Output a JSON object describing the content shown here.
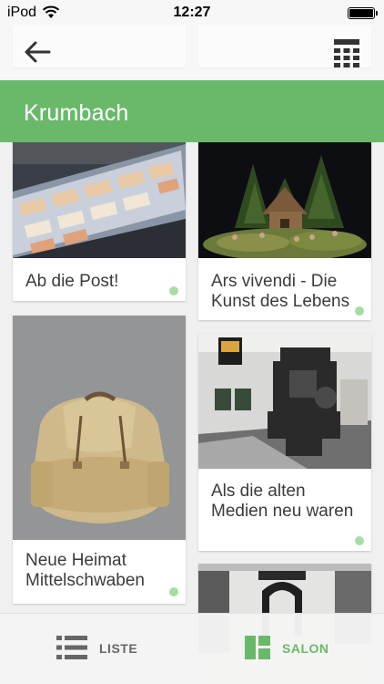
{
  "status": {
    "carrier": "iPod",
    "time": "12:27"
  },
  "nav": {
    "back_icon": "back-arrow-icon",
    "view_icon": "grid-view-icon"
  },
  "header": {
    "title": "Krumbach"
  },
  "cards": [
    {
      "label": "Ab die Post!",
      "image": "display case with postage documents"
    },
    {
      "label": "Ars vivendi - Die Kunst des Lebens",
      "image": "nativity scene with moss"
    },
    {
      "label": "Neue Heimat Mittelschwaben",
      "image": "old canvas backpack"
    },
    {
      "label": "Als die alten Medien neu waren",
      "image": "printing press in museum"
    },
    {
      "label": "",
      "image": "exhibition room with stone arch"
    }
  ],
  "tabs": [
    {
      "label": "LISTE",
      "icon": "list-icon",
      "active": false
    },
    {
      "label": "SALON",
      "icon": "salon-grid-icon",
      "active": true
    }
  ],
  "colors": {
    "accent": "#6ab96b",
    "dot": "#a8dca7",
    "inactive": "#666666"
  }
}
